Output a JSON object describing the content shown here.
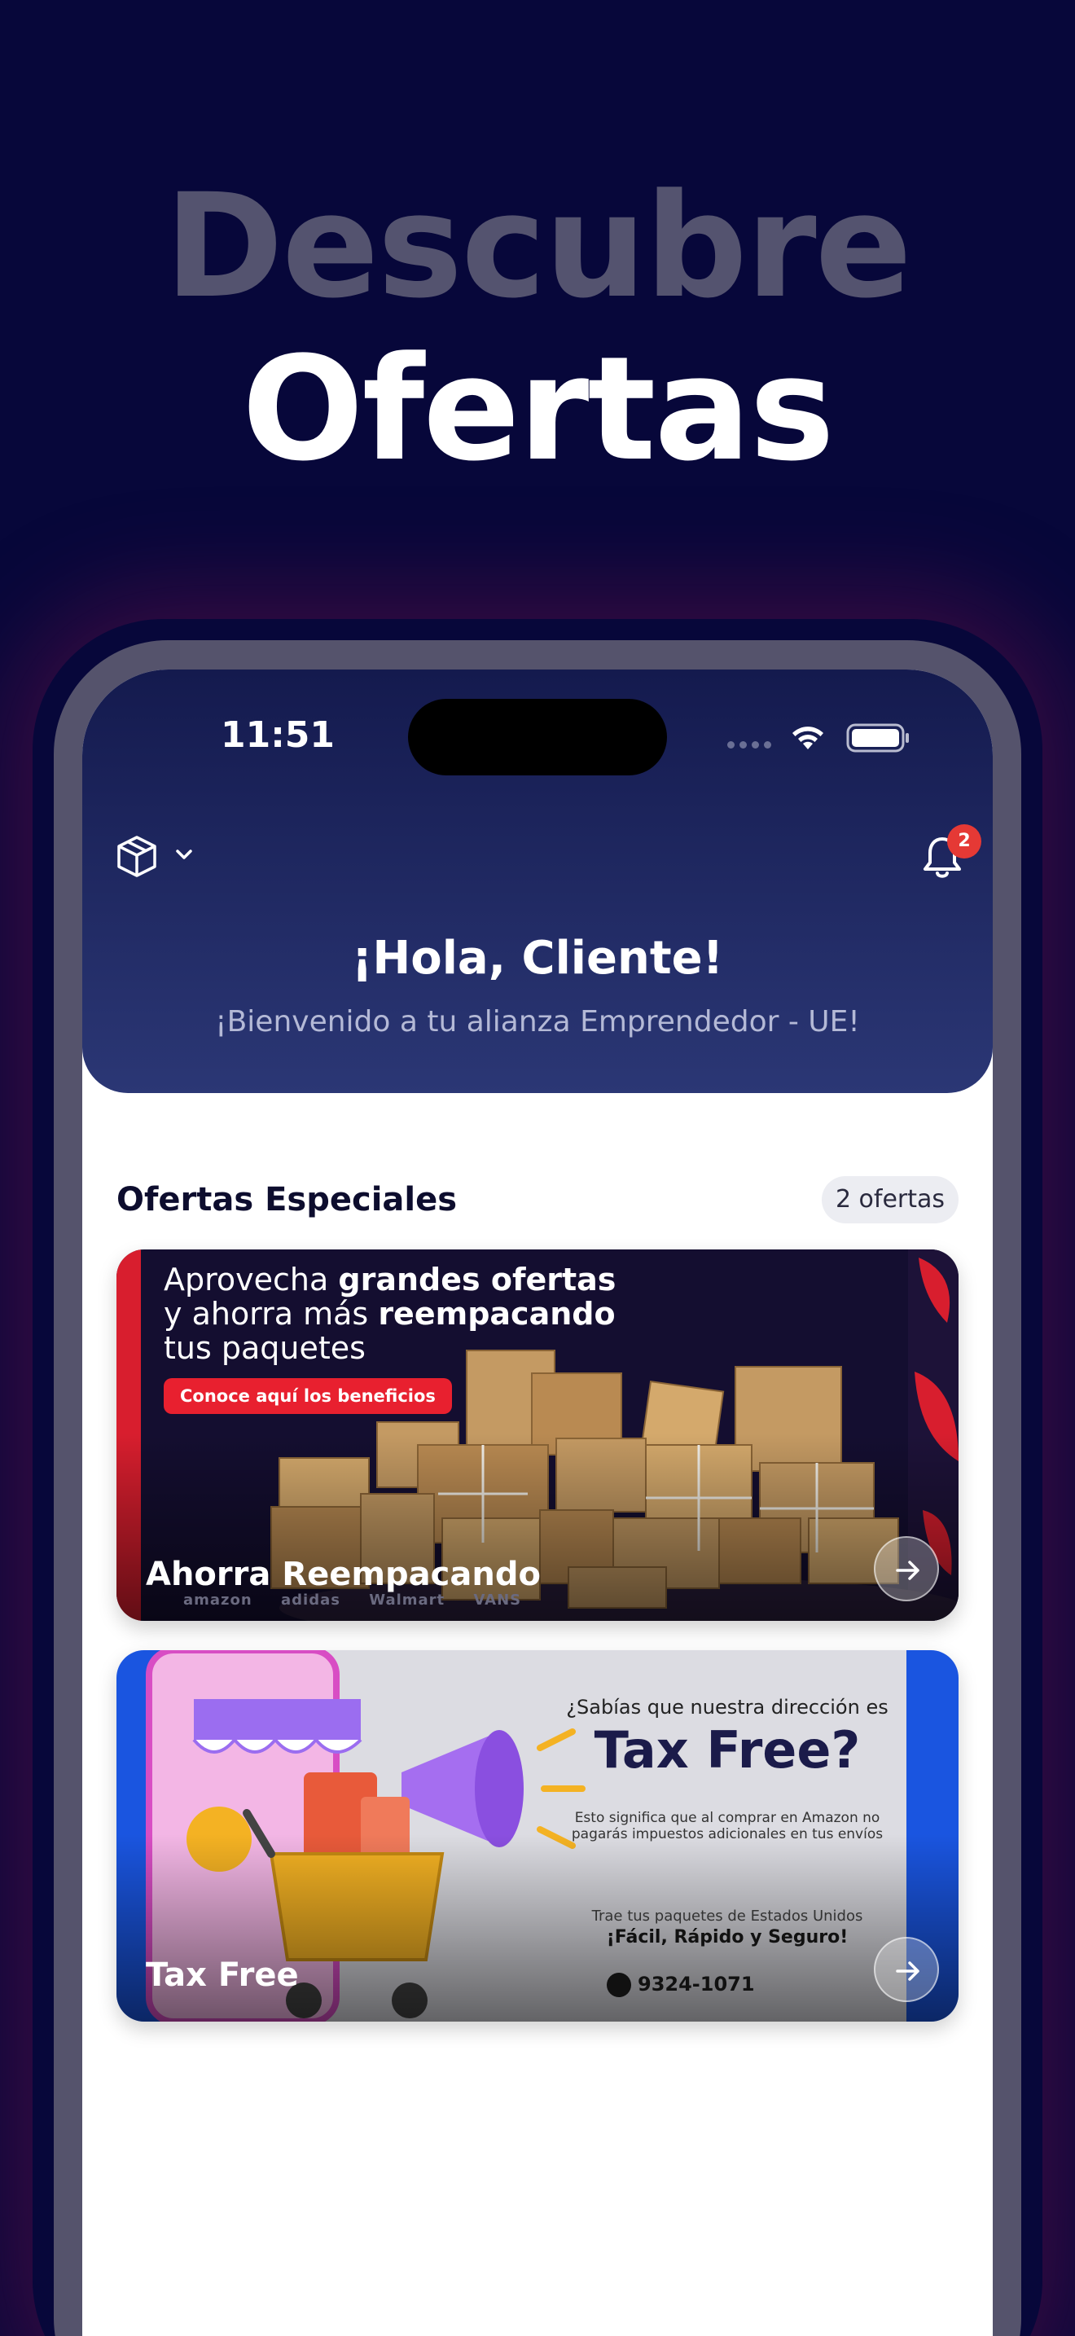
{
  "headline": {
    "line1": "Descubre",
    "line2": "Ofertas"
  },
  "status_bar": {
    "time": "11:51"
  },
  "header": {
    "notification_count": "2",
    "greeting": "¡Hola, Cliente!",
    "welcome": "¡Bienvenido a tu alianza Emprendedor - UE!"
  },
  "offers": {
    "section_title": "Ofertas Especiales",
    "count_label": "2 ofertas",
    "cards": [
      {
        "label": "Ahorra Reempacando",
        "art": {
          "line1_pre": "Aprovecha ",
          "line1_bold": "grandes ofertas",
          "line2_pre": "y ahorra más ",
          "line2_bold": "reempacando",
          "line3": "tus paquetes",
          "pill": "Conoce aquí los beneficios",
          "brands": [
            "amazon",
            "adidas",
            "Walmart",
            "VANS"
          ]
        }
      },
      {
        "label": "Tax Free",
        "art": {
          "question": "¿Sabías que nuestra dirección es",
          "big": "Tax Free?",
          "small": "Esto significa que al comprar en Amazon no pagarás impuestos adicionales en tus envíos",
          "trae": "Trae tus paquetes de Estados Unidos",
          "bold": "¡Fácil, Rápido y Seguro!",
          "phone": "9324-1071"
        }
      }
    ]
  },
  "colors": {
    "page_bg": "#07073a",
    "header_gradient_top": "#141a4e",
    "header_gradient_bottom": "#2b3775",
    "badge": "#e53935",
    "promo_red": "#e8202f",
    "card2_blue": "#1a55e0"
  },
  "icons": [
    "box-icon",
    "chevron-down-icon",
    "bell-icon",
    "wifi-icon",
    "battery-icon",
    "arrow-right-icon",
    "phone-icon"
  ]
}
